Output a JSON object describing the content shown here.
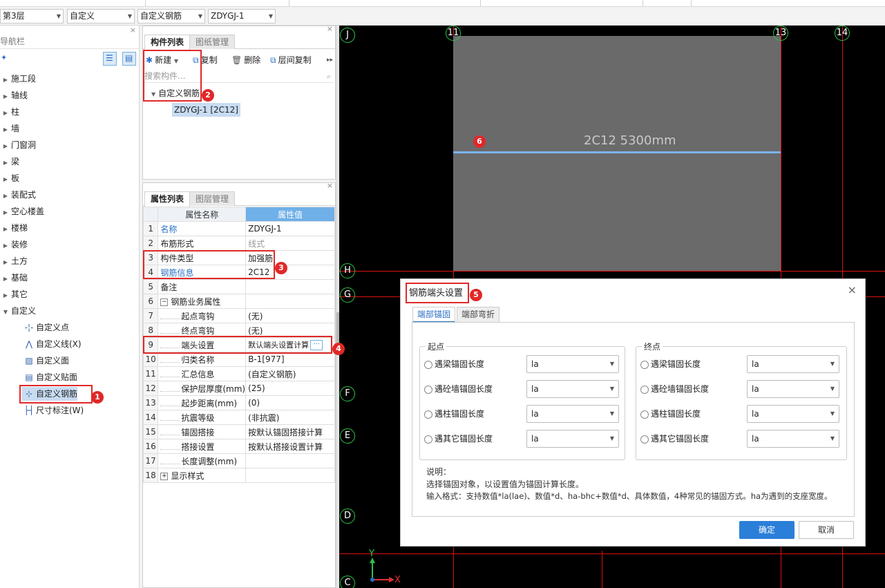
{
  "selectors": {
    "floor": "第3层",
    "type": "自定义",
    "subtype": "自定义钢筋",
    "component": "ZDYGJ-1"
  },
  "nav": {
    "title": "导航栏",
    "close": "×",
    "items": [
      "施工段",
      "轴线",
      "柱",
      "墙",
      "门窗洞",
      "梁",
      "板",
      "装配式",
      "空心楼盖",
      "楼梯",
      "装修",
      "土方",
      "基础",
      "其它"
    ],
    "custom": {
      "label": "自定义",
      "children": [
        "自定义点",
        "自定义线(X)",
        "自定义面",
        "自定义贴面",
        "自定义钢筋",
        "尺寸标注(W)"
      ]
    }
  },
  "component_list": {
    "tabs": [
      "构件列表",
      "图纸管理"
    ],
    "toolbar": {
      "new": "新建",
      "copy": "复制",
      "delete": "删除",
      "floor_copy": "层间复制"
    },
    "search_placeholder": "搜索构件...",
    "tree_root": "自定义钢筋",
    "tree_child": "ZDYGJ-1 [2C12]"
  },
  "properties": {
    "tabs": [
      "属性列表",
      "图层管理"
    ],
    "header_name": "属性名称",
    "header_value": "属性值",
    "rows": [
      {
        "idx": "1",
        "name": "名称",
        "value": "ZDYGJ-1"
      },
      {
        "idx": "2",
        "name": "布筋形式",
        "value": "线式"
      },
      {
        "idx": "3",
        "name": "构件类型",
        "value": "加强筋"
      },
      {
        "idx": "4",
        "name": "钢筋信息",
        "value": "2C12"
      },
      {
        "idx": "5",
        "name": "备注",
        "value": ""
      },
      {
        "idx": "6",
        "name": "钢筋业务属性",
        "value": ""
      },
      {
        "idx": "7",
        "name": "起点弯钩",
        "value": "(无)"
      },
      {
        "idx": "8",
        "name": "终点弯钩",
        "value": "(无)"
      },
      {
        "idx": "9",
        "name": "端头设置",
        "value": "默认端头设置计算"
      },
      {
        "idx": "10",
        "name": "归类名称",
        "value": "B-1[977]"
      },
      {
        "idx": "11",
        "name": "汇总信息",
        "value": "(自定义钢筋)"
      },
      {
        "idx": "12",
        "name": "保护层厚度(mm)",
        "value": "(25)"
      },
      {
        "idx": "13",
        "name": "起步距离(mm)",
        "value": "(0)"
      },
      {
        "idx": "14",
        "name": "抗震等级",
        "value": "(非抗震)"
      },
      {
        "idx": "15",
        "name": "锚固搭接",
        "value": "按默认锚固搭接计算"
      },
      {
        "idx": "16",
        "name": "搭接设置",
        "value": "按默认搭接设置计算"
      },
      {
        "idx": "17",
        "name": "长度调整(mm)",
        "value": ""
      },
      {
        "idx": "18",
        "name": "显示样式",
        "value": ""
      }
    ]
  },
  "canvas": {
    "axes_top": [
      "11",
      "13",
      "14"
    ],
    "axes_left": [
      "J",
      "H",
      "G",
      "F",
      "E",
      "D",
      "C"
    ],
    "rebar_label": "2C12 5300mm",
    "ucs_x": "X",
    "ucs_y": "Y"
  },
  "dialog": {
    "title": "钢筋端头设置",
    "close": "×",
    "tabs": [
      "端部锚固",
      "端部弯折"
    ],
    "start_group": "起点",
    "end_group": "终点",
    "options": [
      "遇梁锚固长度",
      "遇砼墙锚固长度",
      "遇柱锚固长度",
      "遇其它锚固长度"
    ],
    "option_value": "la",
    "note_title": "说明：",
    "note_line1": "选择锚固对象，以设置值为锚固计算长度。",
    "note_line2": "输入格式：支持数值*la(lae)、数值*d、ha-bhc+数值*d、具体数值，4种常见的锚固方式。ha为遇到的支座宽度。",
    "ok": "确定",
    "cancel": "取消"
  },
  "annotations": [
    "1",
    "2",
    "3",
    "4",
    "5",
    "6"
  ],
  "colors": {
    "accent": "#2b7fd9",
    "annotation": "#e02828",
    "axis": "#2cc44a",
    "rebar": "#7cb3f0"
  }
}
